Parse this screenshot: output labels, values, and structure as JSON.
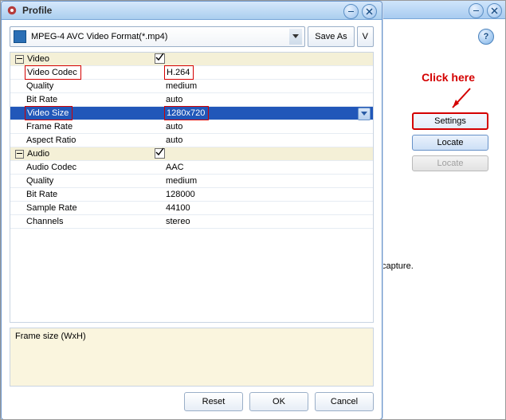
{
  "back_window": {
    "text_fragment": "capture."
  },
  "side_buttons": {
    "settings": "Settings",
    "locate": "Locate",
    "locate_disabled": "Locate"
  },
  "annotation": {
    "click_here": "Click here"
  },
  "dialog": {
    "title": "Profile",
    "profile_select": "MPEG-4 AVC Video Format(*.mp4)",
    "save_as": "Save As",
    "v": "V",
    "group_video": "Video",
    "group_audio": "Audio",
    "video_codec": {
      "label": "Video Codec",
      "value": "H.264"
    },
    "quality_v": {
      "label": "Quality",
      "value": "medium"
    },
    "bit_rate_v": {
      "label": "Bit Rate",
      "value": "auto"
    },
    "video_size": {
      "label": "Video Size",
      "value": "1280x720"
    },
    "frame_rate": {
      "label": "Frame Rate",
      "value": "auto"
    },
    "aspect_ratio": {
      "label": "Aspect Ratio",
      "value": "auto"
    },
    "audio_codec": {
      "label": "Audio Codec",
      "value": "AAC"
    },
    "quality_a": {
      "label": "Quality",
      "value": "medium"
    },
    "bit_rate_a": {
      "label": "Bit Rate",
      "value": "128000"
    },
    "sample_rate": {
      "label": "Sample Rate",
      "value": "44100"
    },
    "channels": {
      "label": "Channels",
      "value": "stereo"
    },
    "description": "Frame size (WxH)",
    "reset": "Reset",
    "ok": "OK",
    "cancel": "Cancel"
  }
}
